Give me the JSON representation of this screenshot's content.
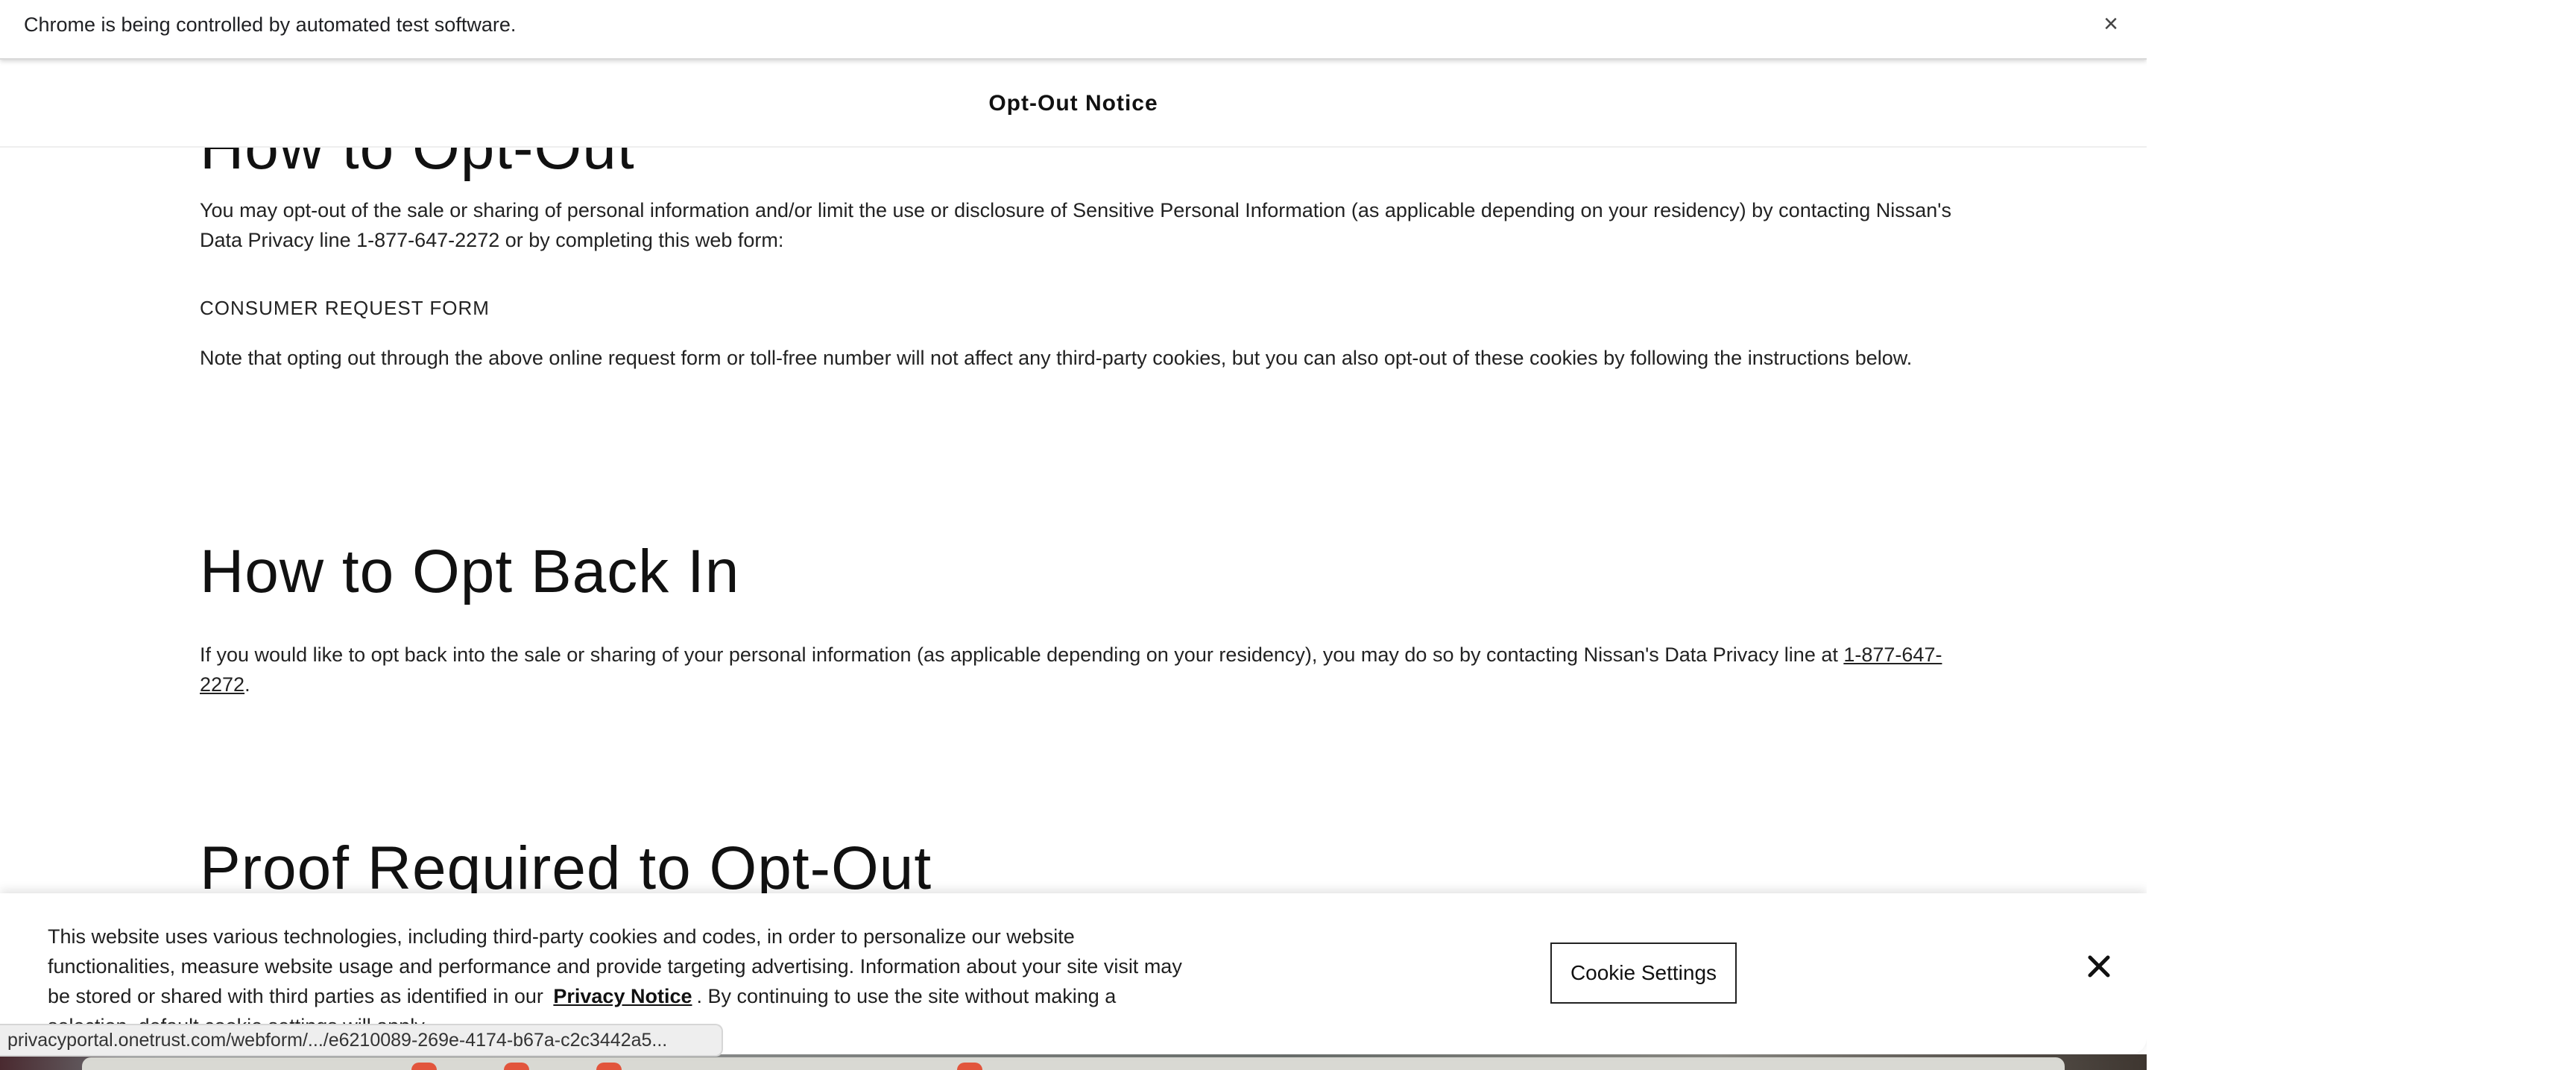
{
  "infobar": {
    "message": "Chrome is being controlled by automated test software.",
    "close_label": "×"
  },
  "header": {
    "title": "Opt-Out Notice"
  },
  "sections": {
    "opt_out": {
      "heading": "How to Opt-Out",
      "paragraph1": "You may opt-out of the sale or sharing of personal information and/or limit the use or disclosure of Sensitive Personal Information (as applicable depending on your residency) by contacting Nissan's Data Privacy line 1-877-647-2272 or by completing this web form:",
      "form_label": "CONSUMER REQUEST FORM",
      "paragraph2": "Note that opting out through the above online request form or toll-free number will not affect any third-party cookies, but you can also opt-out of these cookies by following the instructions below."
    },
    "opt_back_in": {
      "heading": "How to Opt Back In",
      "paragraph_before_link": "If you would like to opt back into the sale or sharing of your personal information (as applicable depending on your residency), you may do so by contacting Nissan's Data Privacy line at ",
      "phone_link": "1-877-647-2272",
      "paragraph_after_link": "."
    },
    "proof_required": {
      "heading": "Proof Required to Opt-Out"
    }
  },
  "cookie_banner": {
    "text_before_link": "This website uses various technologies, including third-party cookies and codes, in order to personalize our website functionalities, measure website usage and performance and provide targeting advertising. Information about your site visit may be stored or shared with third parties as identified in our ",
    "link_label": "Privacy Notice",
    "text_after_link": ". By continuing to use the site without making a selection, default cookie settings will apply.",
    "settings_button": "Cookie Settings",
    "close_icon": "close-icon"
  },
  "status_bar": {
    "url": "privacyportal.onetrust.com/webform/.../e6210089-269e-4174-b67a-c2c3442a5..."
  },
  "colors": {
    "text": "#222222",
    "dot_accent": "#e2553c"
  }
}
